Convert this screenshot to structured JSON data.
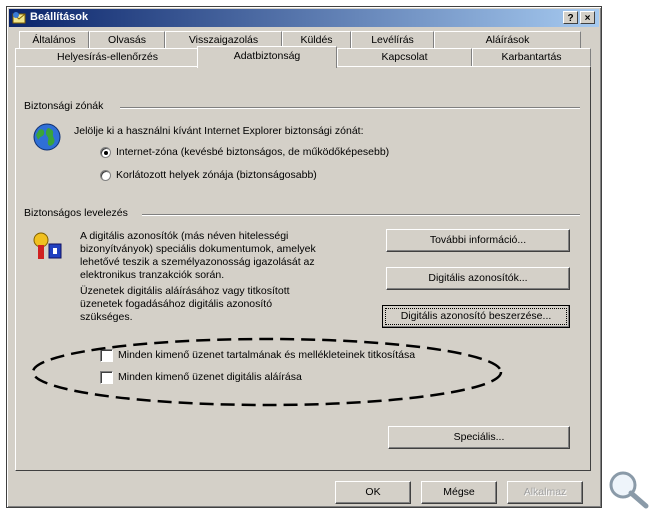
{
  "window": {
    "title": "Beállítások",
    "help_label": "?",
    "close_label": "×"
  },
  "tabs": {
    "row1": [
      "Általános",
      "Olvasás",
      "Visszaigazolás",
      "Küldés",
      "Levélírás",
      "Aláírások"
    ],
    "row2": [
      "Helyesírás-ellenőrzés",
      "Adatbiztonság",
      "Kapcsolat",
      "Karbantartás"
    ],
    "active": "Adatbiztonság"
  },
  "zones": {
    "label": "Biztonsági zónák",
    "description": "Jelölje ki a használni kívánt Internet Explorer biztonsági zónát:",
    "options": [
      {
        "label": "Internet-zóna (kevésbé biztonságos, de működőképesebb)",
        "selected": true
      },
      {
        "label": "Korlátozott helyek zónája (biztonságosabb)",
        "selected": false
      }
    ]
  },
  "secure_mail": {
    "label": "Biztonságos levelezés",
    "text1": [
      "A digitális azonosítók (más néven hitelességi",
      "bizonyítványok) speciális dokumentumok, amelyek",
      "lehetővé teszik a személyazonosság igazolását az",
      "elektronikus tranzakciók során."
    ],
    "text2": [
      "Üzenetek digitális aláírásához vagy titkosított",
      "üzenetek fogadásához digitális azonosító",
      "szükséges."
    ],
    "buttons": {
      "more_info": "További információ...",
      "digital_ids": "Digitális azonosítók...",
      "get_id": "Digitális azonosító beszerzése..."
    }
  },
  "checkboxes": [
    {
      "label": "Minden kimenő üzenet tartalmának és mellékleteinek titkosítása",
      "checked": false
    },
    {
      "label": "Minden kimenő üzenet digitális aláírása",
      "checked": false
    }
  ],
  "advanced_button": "Speciális...",
  "footer": {
    "ok": "OK",
    "cancel": "Mégse",
    "apply": "Alkalmaz"
  }
}
